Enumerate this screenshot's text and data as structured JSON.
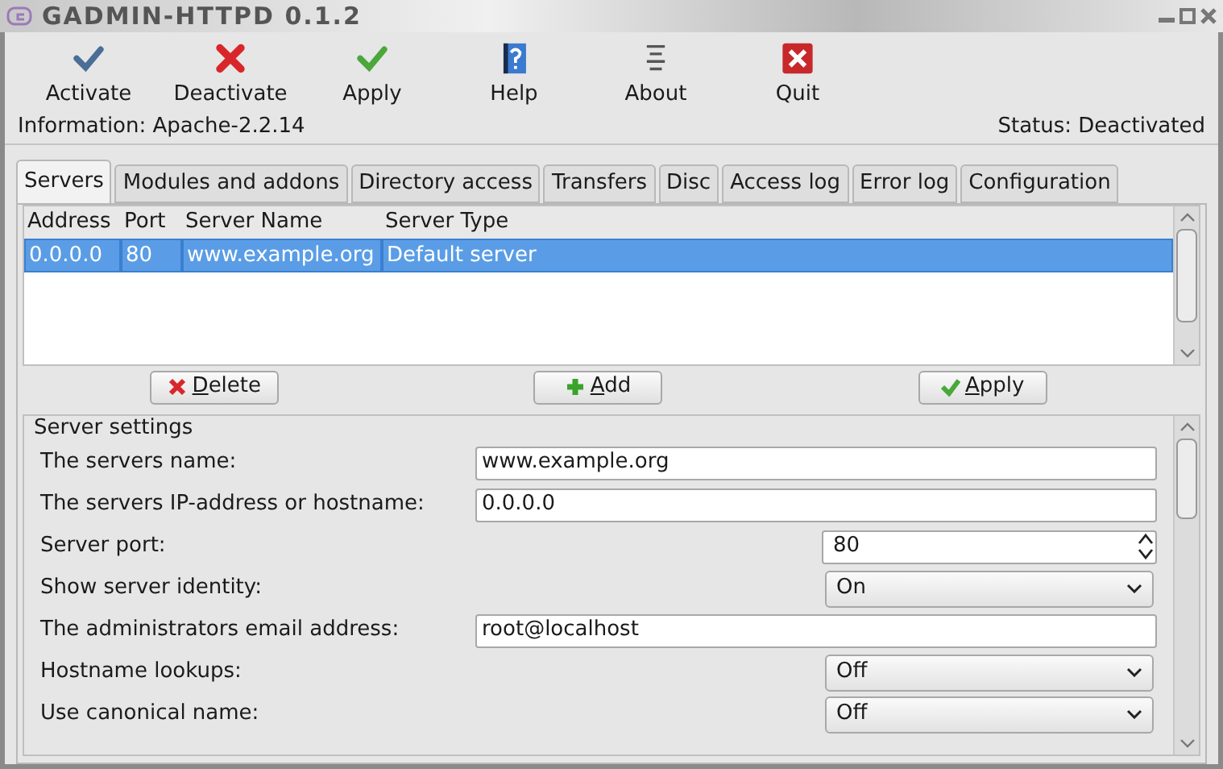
{
  "window": {
    "title": "GADMIN-HTTPD 0.1.2"
  },
  "toolbar": [
    "Activate",
    "Deactivate",
    "Apply",
    "Help",
    "About",
    "Quit"
  ],
  "information": "Information: Apache-2.2.14",
  "status": "Status: Deactivated",
  "tabs": [
    {
      "label": "Servers",
      "selected": true
    },
    {
      "label": "Modules and addons",
      "selected": false
    },
    {
      "label": "Directory access",
      "selected": false
    },
    {
      "label": "Transfers",
      "selected": false
    },
    {
      "label": "Disc",
      "selected": false
    },
    {
      "label": "Access log",
      "selected": false
    },
    {
      "label": "Error log",
      "selected": false
    },
    {
      "label": "Configuration",
      "selected": false
    }
  ],
  "table": {
    "columns": [
      "Address",
      "Port",
      "Server Name",
      "Server Type"
    ],
    "rows": [
      {
        "cells": [
          "0.0.0.0",
          "80",
          "www.example.org",
          "Default server"
        ],
        "selected": true
      }
    ]
  },
  "table_buttons": [
    "Delete",
    "Add",
    "Apply"
  ],
  "settings": {
    "title": "Server settings",
    "rows": [
      {
        "kind": "text",
        "label": "The servers name:",
        "value": "www.example.org"
      },
      {
        "kind": "text",
        "label": "The servers IP-address or hostname:",
        "value": "0.0.0.0"
      },
      {
        "kind": "spin",
        "label": "Server port:",
        "value": "80"
      },
      {
        "kind": "select",
        "label": "Show server identity:",
        "value": "On"
      },
      {
        "kind": "text",
        "label": "The administrators email address:",
        "value": "root@localhost"
      },
      {
        "kind": "select",
        "label": "Hostname lookups:",
        "value": "Off"
      },
      {
        "kind": "select",
        "label": "Use canonical name:",
        "value": "Off"
      }
    ]
  }
}
